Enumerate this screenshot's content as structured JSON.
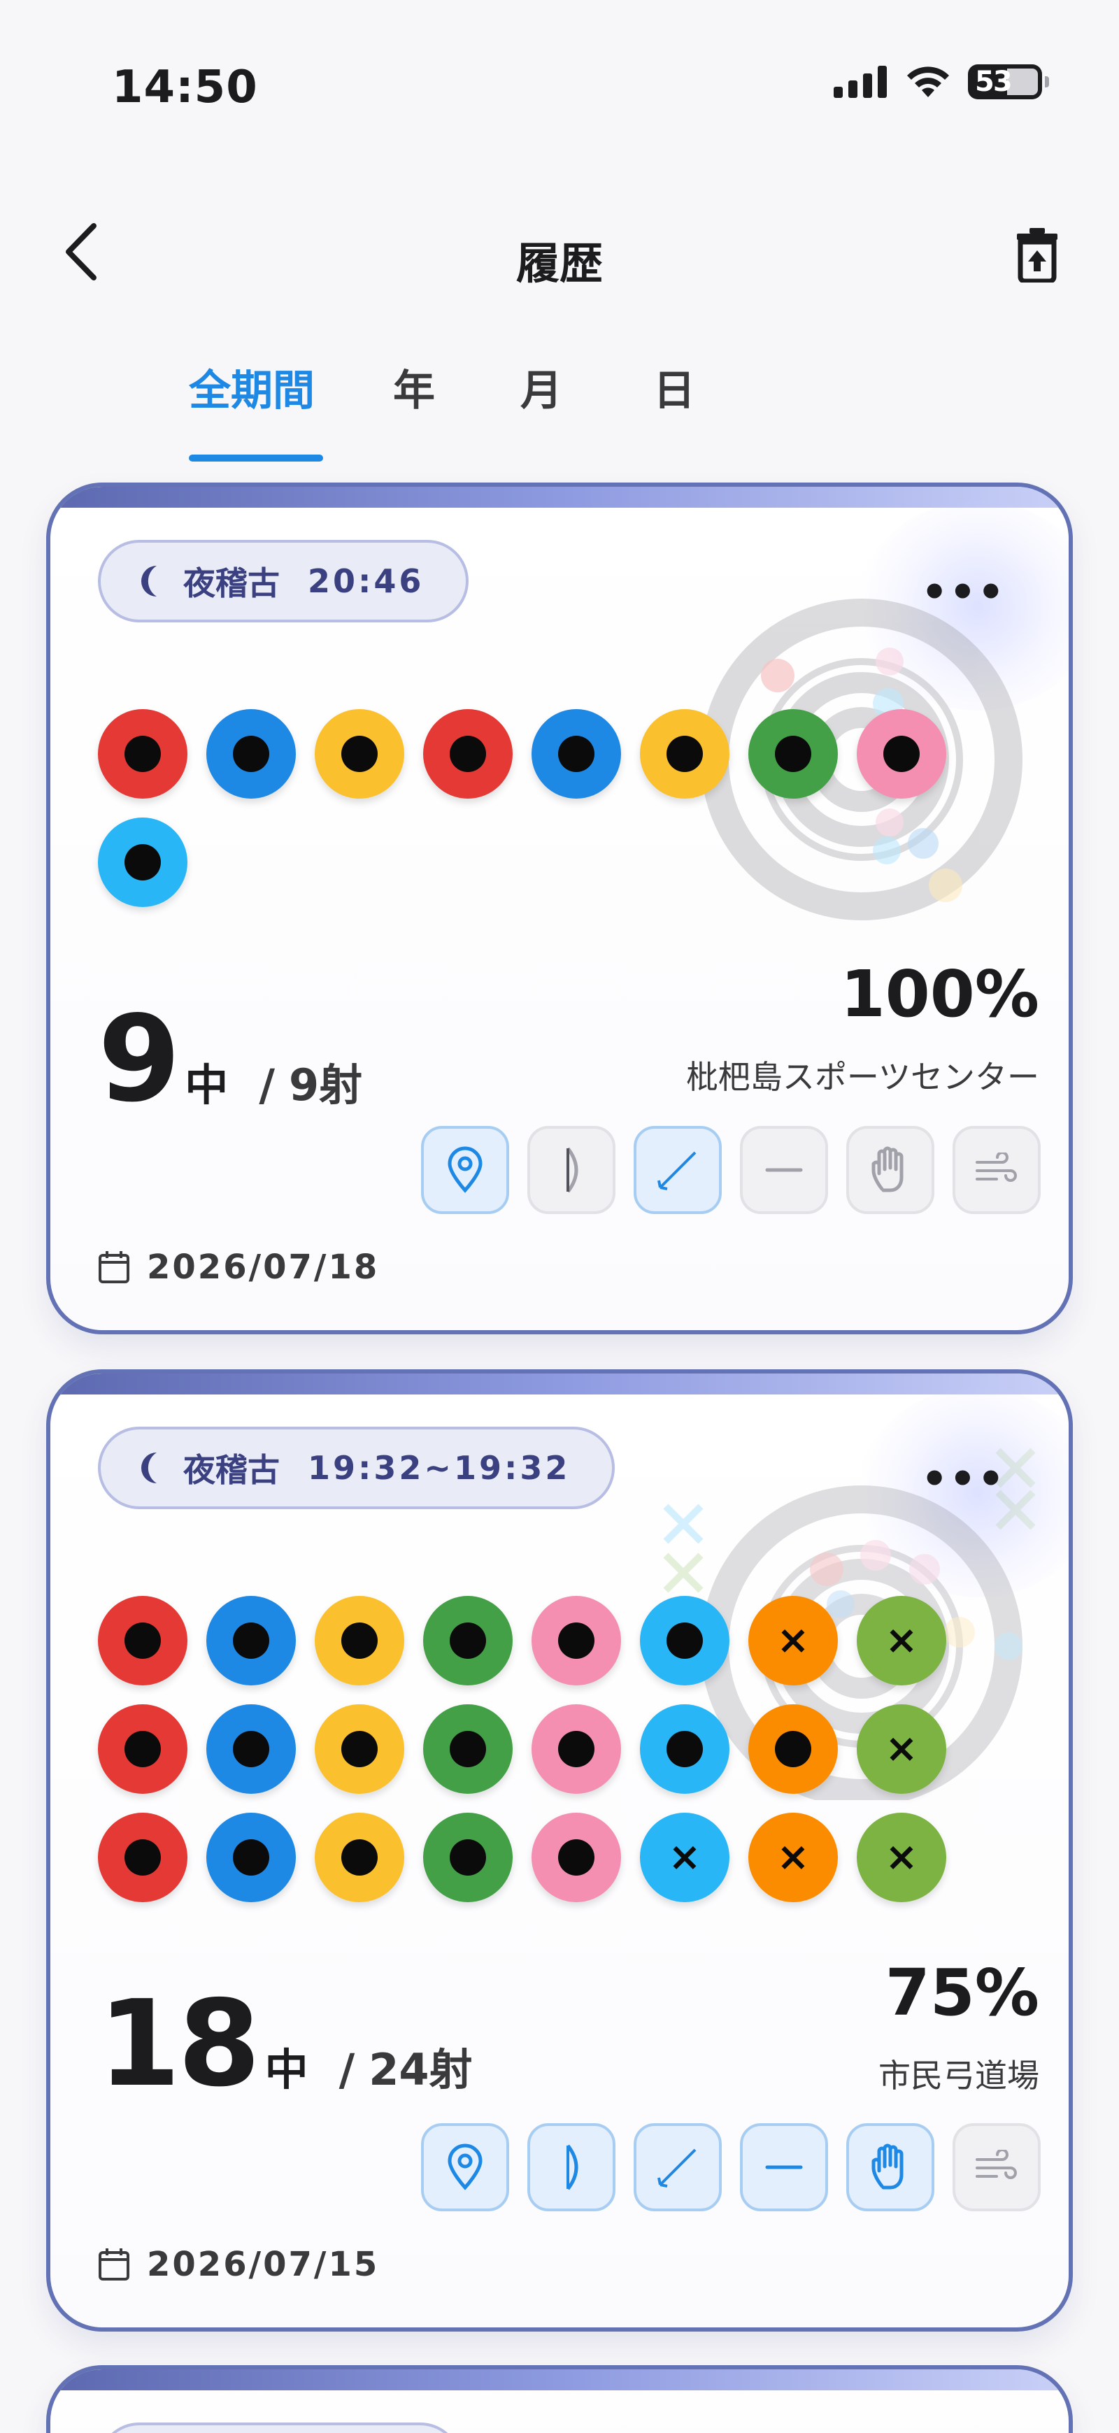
{
  "status_bar": {
    "time": "14:50",
    "battery": "53"
  },
  "header": {
    "title": "履歴"
  },
  "tabs": [
    {
      "label": "全期間",
      "active": true
    },
    {
      "label": "年",
      "active": false
    },
    {
      "label": "月",
      "active": false
    },
    {
      "label": "日",
      "active": false
    }
  ],
  "colors": {
    "accent": "#1e88e5",
    "card_border": "#6372b5",
    "shot_red": "#e53935",
    "shot_blue": "#1e88e5",
    "shot_yellow": "#fbc02d",
    "shot_green": "#43a047",
    "shot_pink": "#f48fb1",
    "shot_sky": "#29b6f6",
    "shot_orange": "#fb8c00",
    "shot_lime": "#7cb342"
  },
  "records": [
    {
      "session_label": "夜稽古",
      "session_time": "20:46",
      "hits": "9",
      "hits_unit": "中",
      "separator": "/",
      "shots_total": "9射",
      "percent": "100%",
      "venue": "枇杷島スポーツセンター",
      "date": "2026/07/18",
      "shots": [
        {
          "color": "red",
          "hit": true
        },
        {
          "color": "blue",
          "hit": true
        },
        {
          "color": "yellow",
          "hit": true
        },
        {
          "color": "red",
          "hit": true
        },
        {
          "color": "blue",
          "hit": true
        },
        {
          "color": "yellow",
          "hit": true
        },
        {
          "color": "green",
          "hit": true
        },
        {
          "color": "pink",
          "hit": true
        },
        {
          "color": "sky",
          "hit": true
        }
      ],
      "settings": [
        {
          "icon": "location-pin-icon",
          "on": true
        },
        {
          "icon": "bow-icon",
          "on": false
        },
        {
          "icon": "arrow-icon",
          "on": true
        },
        {
          "icon": "string-icon",
          "on": false
        },
        {
          "icon": "glove-icon",
          "on": false
        },
        {
          "icon": "wind-icon",
          "on": false
        }
      ]
    },
    {
      "session_label": "夜稽古",
      "session_time": "19:32~19:32",
      "hits": "18",
      "hits_unit": "中",
      "separator": "/",
      "shots_total": "24射",
      "percent": "75%",
      "venue": "市民弓道場",
      "date": "2026/07/15",
      "shots": [
        {
          "color": "red",
          "hit": true
        },
        {
          "color": "blue",
          "hit": true
        },
        {
          "color": "yellow",
          "hit": true
        },
        {
          "color": "green",
          "hit": true
        },
        {
          "color": "pink",
          "hit": true
        },
        {
          "color": "sky",
          "hit": true
        },
        {
          "color": "orange",
          "hit": false
        },
        {
          "color": "lime",
          "hit": false
        },
        {
          "color": "red",
          "hit": true
        },
        {
          "color": "blue",
          "hit": true
        },
        {
          "color": "yellow",
          "hit": true
        },
        {
          "color": "green",
          "hit": true
        },
        {
          "color": "pink",
          "hit": true
        },
        {
          "color": "sky",
          "hit": true
        },
        {
          "color": "orange",
          "hit": true
        },
        {
          "color": "lime",
          "hit": false
        },
        {
          "color": "red",
          "hit": true
        },
        {
          "color": "blue",
          "hit": true
        },
        {
          "color": "yellow",
          "hit": true
        },
        {
          "color": "green",
          "hit": true
        },
        {
          "color": "pink",
          "hit": true
        },
        {
          "color": "sky",
          "hit": false
        },
        {
          "color": "orange",
          "hit": false
        },
        {
          "color": "lime",
          "hit": false
        }
      ],
      "settings": [
        {
          "icon": "location-pin-icon",
          "on": true
        },
        {
          "icon": "bow-icon",
          "on": true
        },
        {
          "icon": "arrow-icon",
          "on": true
        },
        {
          "icon": "string-icon",
          "on": true
        },
        {
          "icon": "glove-icon",
          "on": true
        },
        {
          "icon": "wind-icon",
          "on": false
        }
      ]
    }
  ]
}
